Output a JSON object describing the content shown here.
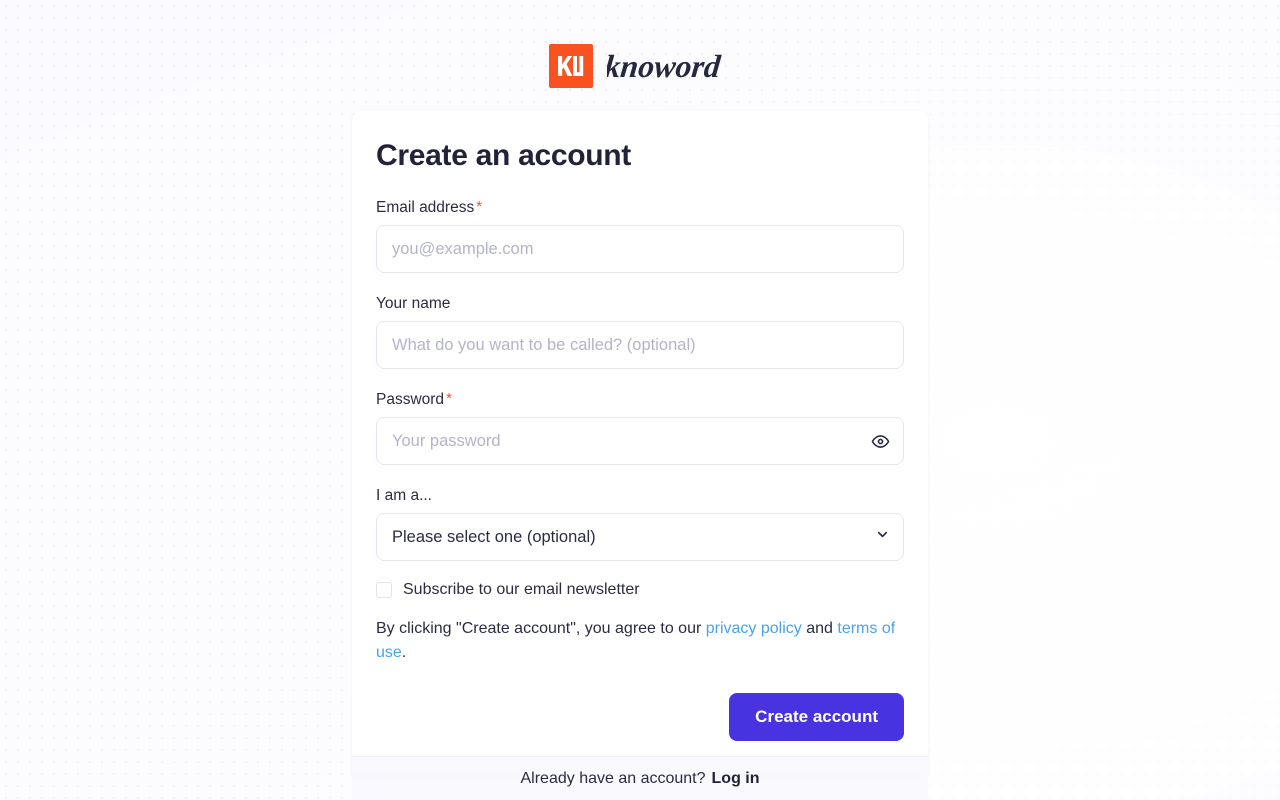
{
  "brand": {
    "name": "knoword",
    "mark_icon": "knoword-monogram-icon",
    "mark_color": "#F9511F",
    "wordmark_color": "#262840"
  },
  "card": {
    "title": "Create an account",
    "fields": {
      "email": {
        "label": "Email address",
        "required_marker": "*",
        "placeholder": "you@example.com",
        "value": ""
      },
      "name": {
        "label": "Your name",
        "placeholder": "What do you want to be called? (optional)",
        "value": ""
      },
      "password": {
        "label": "Password",
        "required_marker": "*",
        "placeholder": "Your password",
        "value": "",
        "toggle_icon": "eye-icon"
      },
      "role": {
        "label": "I am a...",
        "selected": "Please select one (optional)",
        "chevron_icon": "chevron-down-icon"
      }
    },
    "newsletter": {
      "label": "Subscribe to our email newsletter",
      "checked": false
    },
    "terms": {
      "prefix": "By clicking \"Create account\", you agree to our ",
      "privacy_link": "privacy policy",
      "middle": " and ",
      "terms_link": "terms of use",
      "suffix": "."
    },
    "submit_label": "Create account"
  },
  "footer": {
    "prompt": "Already have an account?",
    "login_label": "Log in"
  },
  "colors": {
    "accent_orange": "#F9511F",
    "primary_button": "#4733E0",
    "link_blue": "#4AA3E6",
    "text_dark": "#2B2C42",
    "page_background": "#FAFAFF"
  }
}
